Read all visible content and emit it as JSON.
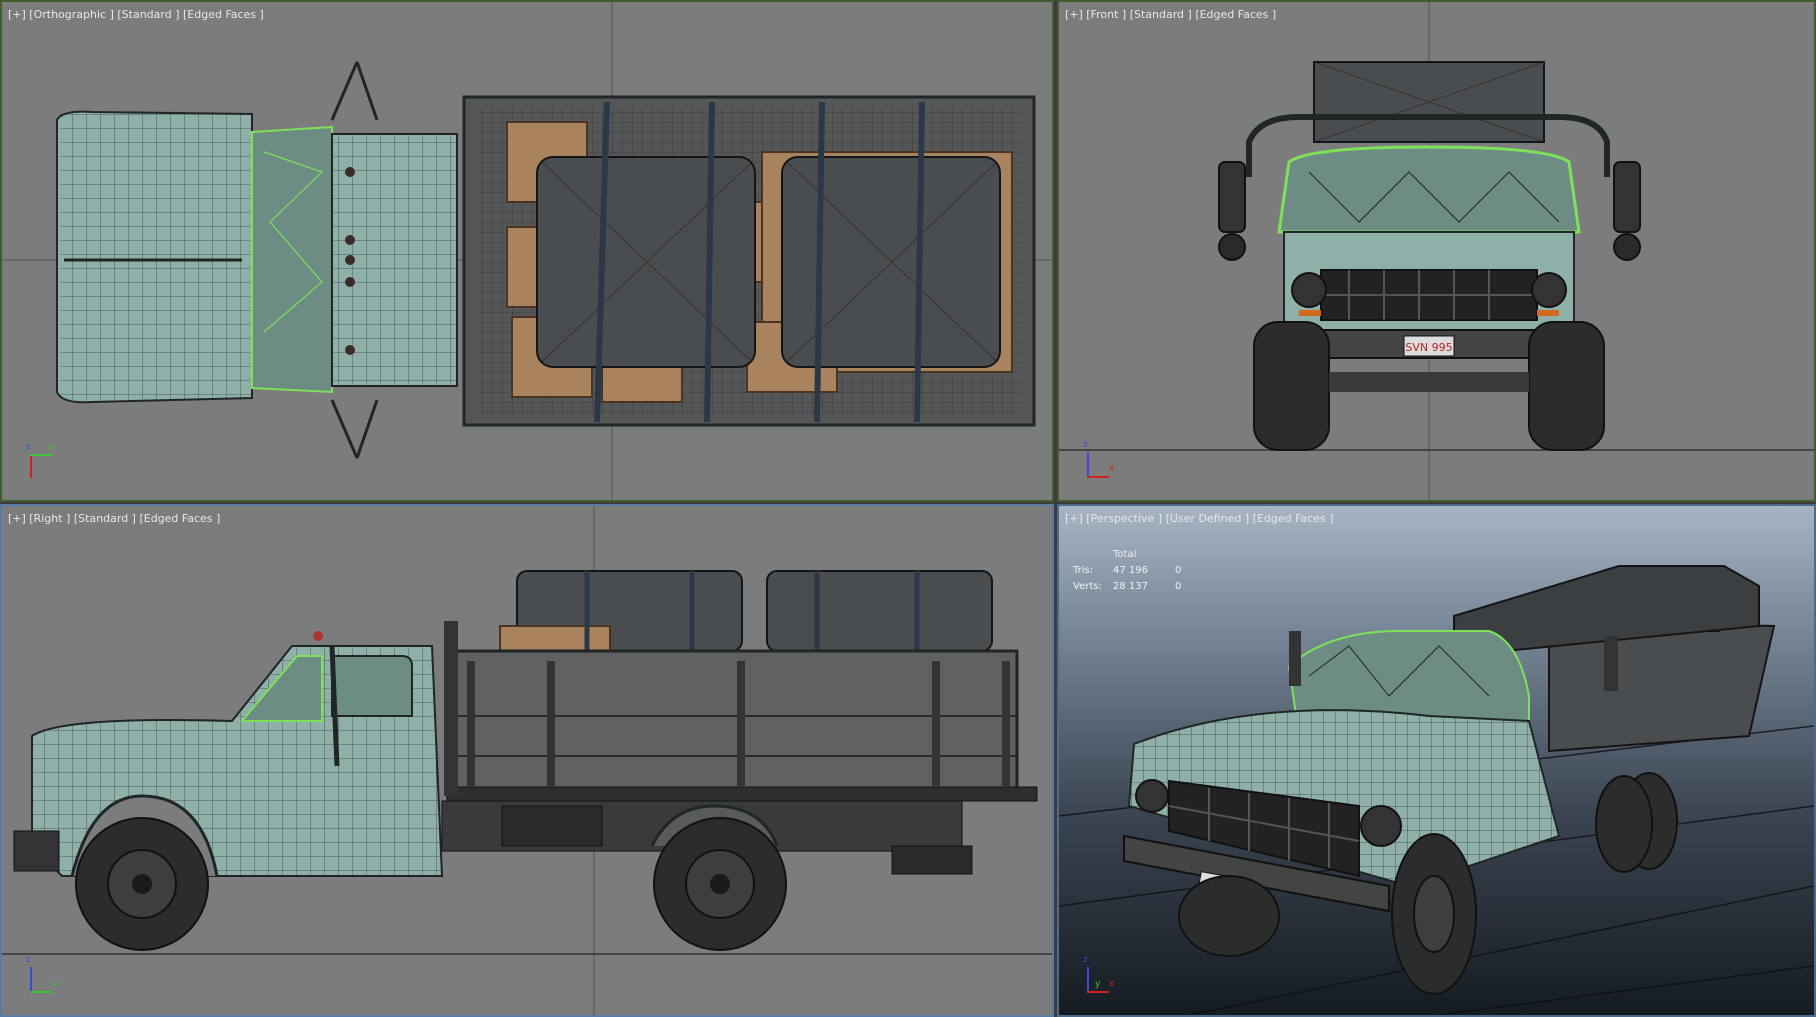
{
  "viewports": {
    "top": {
      "label": "[+] [Orthographic ] [Standard ] [Edged Faces ]"
    },
    "front": {
      "label": "[+] [Front ] [Standard ] [Edged Faces ]"
    },
    "right": {
      "label": "[+] [Right ] [Standard ] [Edged Faces ]"
    },
    "persp": {
      "label": "[+] [Perspective ] [User Defined ] [Edged Faces ]"
    }
  },
  "stats": {
    "header": "Total",
    "tris_label": "Tris:",
    "tris_total": "47 196",
    "tris_sel": "0",
    "verts_label": "Verts:",
    "verts_total": "28 137",
    "verts_sel": "0"
  },
  "axes": {
    "x": "x",
    "y": "y",
    "z": "z"
  },
  "license_plate": "SVN 995",
  "colors": {
    "viewport_bg": "#7c7c7c",
    "active_border": "#5a7aa6",
    "truck_body": "#8fb0a8",
    "wire": "#1f2624",
    "glass_wire": "#7fe05a",
    "crate": "#a9825e",
    "tarp": "#4a4d50"
  }
}
